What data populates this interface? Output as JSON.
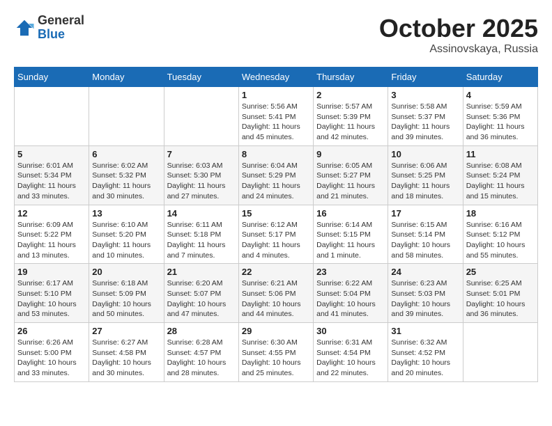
{
  "logo": {
    "general": "General",
    "blue": "Blue"
  },
  "title": "October 2025",
  "location": "Assinovskaya, Russia",
  "weekdays": [
    "Sunday",
    "Monday",
    "Tuesday",
    "Wednesday",
    "Thursday",
    "Friday",
    "Saturday"
  ],
  "weeks": [
    [
      {
        "day": "",
        "info": ""
      },
      {
        "day": "",
        "info": ""
      },
      {
        "day": "",
        "info": ""
      },
      {
        "day": "1",
        "info": "Sunrise: 5:56 AM\nSunset: 5:41 PM\nDaylight: 11 hours\nand 45 minutes."
      },
      {
        "day": "2",
        "info": "Sunrise: 5:57 AM\nSunset: 5:39 PM\nDaylight: 11 hours\nand 42 minutes."
      },
      {
        "day": "3",
        "info": "Sunrise: 5:58 AM\nSunset: 5:37 PM\nDaylight: 11 hours\nand 39 minutes."
      },
      {
        "day": "4",
        "info": "Sunrise: 5:59 AM\nSunset: 5:36 PM\nDaylight: 11 hours\nand 36 minutes."
      }
    ],
    [
      {
        "day": "5",
        "info": "Sunrise: 6:01 AM\nSunset: 5:34 PM\nDaylight: 11 hours\nand 33 minutes."
      },
      {
        "day": "6",
        "info": "Sunrise: 6:02 AM\nSunset: 5:32 PM\nDaylight: 11 hours\nand 30 minutes."
      },
      {
        "day": "7",
        "info": "Sunrise: 6:03 AM\nSunset: 5:30 PM\nDaylight: 11 hours\nand 27 minutes."
      },
      {
        "day": "8",
        "info": "Sunrise: 6:04 AM\nSunset: 5:29 PM\nDaylight: 11 hours\nand 24 minutes."
      },
      {
        "day": "9",
        "info": "Sunrise: 6:05 AM\nSunset: 5:27 PM\nDaylight: 11 hours\nand 21 minutes."
      },
      {
        "day": "10",
        "info": "Sunrise: 6:06 AM\nSunset: 5:25 PM\nDaylight: 11 hours\nand 18 minutes."
      },
      {
        "day": "11",
        "info": "Sunrise: 6:08 AM\nSunset: 5:24 PM\nDaylight: 11 hours\nand 15 minutes."
      }
    ],
    [
      {
        "day": "12",
        "info": "Sunrise: 6:09 AM\nSunset: 5:22 PM\nDaylight: 11 hours\nand 13 minutes."
      },
      {
        "day": "13",
        "info": "Sunrise: 6:10 AM\nSunset: 5:20 PM\nDaylight: 11 hours\nand 10 minutes."
      },
      {
        "day": "14",
        "info": "Sunrise: 6:11 AM\nSunset: 5:18 PM\nDaylight: 11 hours\nand 7 minutes."
      },
      {
        "day": "15",
        "info": "Sunrise: 6:12 AM\nSunset: 5:17 PM\nDaylight: 11 hours\nand 4 minutes."
      },
      {
        "day": "16",
        "info": "Sunrise: 6:14 AM\nSunset: 5:15 PM\nDaylight: 11 hours\nand 1 minute."
      },
      {
        "day": "17",
        "info": "Sunrise: 6:15 AM\nSunset: 5:14 PM\nDaylight: 10 hours\nand 58 minutes."
      },
      {
        "day": "18",
        "info": "Sunrise: 6:16 AM\nSunset: 5:12 PM\nDaylight: 10 hours\nand 55 minutes."
      }
    ],
    [
      {
        "day": "19",
        "info": "Sunrise: 6:17 AM\nSunset: 5:10 PM\nDaylight: 10 hours\nand 53 minutes."
      },
      {
        "day": "20",
        "info": "Sunrise: 6:18 AM\nSunset: 5:09 PM\nDaylight: 10 hours\nand 50 minutes."
      },
      {
        "day": "21",
        "info": "Sunrise: 6:20 AM\nSunset: 5:07 PM\nDaylight: 10 hours\nand 47 minutes."
      },
      {
        "day": "22",
        "info": "Sunrise: 6:21 AM\nSunset: 5:06 PM\nDaylight: 10 hours\nand 44 minutes."
      },
      {
        "day": "23",
        "info": "Sunrise: 6:22 AM\nSunset: 5:04 PM\nDaylight: 10 hours\nand 41 minutes."
      },
      {
        "day": "24",
        "info": "Sunrise: 6:23 AM\nSunset: 5:03 PM\nDaylight: 10 hours\nand 39 minutes."
      },
      {
        "day": "25",
        "info": "Sunrise: 6:25 AM\nSunset: 5:01 PM\nDaylight: 10 hours\nand 36 minutes."
      }
    ],
    [
      {
        "day": "26",
        "info": "Sunrise: 6:26 AM\nSunset: 5:00 PM\nDaylight: 10 hours\nand 33 minutes."
      },
      {
        "day": "27",
        "info": "Sunrise: 6:27 AM\nSunset: 4:58 PM\nDaylight: 10 hours\nand 30 minutes."
      },
      {
        "day": "28",
        "info": "Sunrise: 6:28 AM\nSunset: 4:57 PM\nDaylight: 10 hours\nand 28 minutes."
      },
      {
        "day": "29",
        "info": "Sunrise: 6:30 AM\nSunset: 4:55 PM\nDaylight: 10 hours\nand 25 minutes."
      },
      {
        "day": "30",
        "info": "Sunrise: 6:31 AM\nSunset: 4:54 PM\nDaylight: 10 hours\nand 22 minutes."
      },
      {
        "day": "31",
        "info": "Sunrise: 6:32 AM\nSunset: 4:52 PM\nDaylight: 10 hours\nand 20 minutes."
      },
      {
        "day": "",
        "info": ""
      }
    ]
  ]
}
